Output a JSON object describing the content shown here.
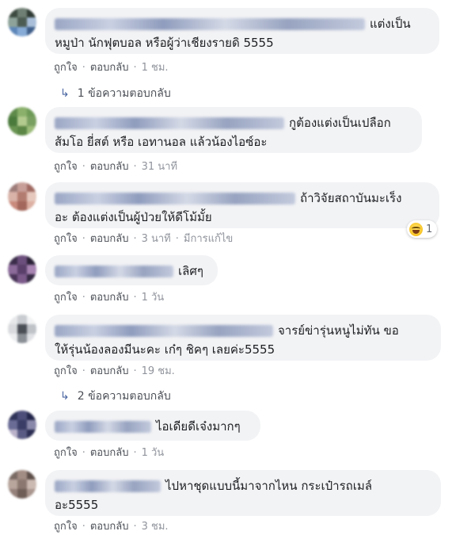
{
  "labels": {
    "like": "ถูกใจ",
    "reply": "ตอบกลับ",
    "edited": "มีการแก้ไข"
  },
  "comments": [
    {
      "text_line1": "แต่งเป็น",
      "text_line2": "หมูป่า นักฟุตบอล หรือผู้ว่าเชียงรายดิ 5555",
      "time": "1 ชม.",
      "replies": "1 ข้อความตอบกลับ"
    },
    {
      "text_line1": "กูต้องแต่งเป็นเปลือก",
      "text_line2": "ส้มโอ ยี่สต์ หรือ เอทานอล แล้วน้องไอซ์อะ",
      "time": "31 นาที"
    },
    {
      "text_line1": "ถ้าวิจัยสถาบันมะเร็ง",
      "text_line2": "อะ ต้องแต่งเป็นผู้ป่วยให้ดีโม้มั้ย",
      "time": "3 นาที",
      "reaction_count": "1"
    },
    {
      "text_line1": "เลิศๆ",
      "time": "1 วัน"
    },
    {
      "text_line1": "จารย์ข่ารุ่นหนูไม่ทัน ขอ",
      "text_line2": "ให้รุ่นน้องลองมีนะคะ เก๋ๆ ชิคๆ เลยค่ะ5555",
      "time": "19 ชม.",
      "replies": "2 ข้อความตอบกลับ"
    },
    {
      "text_line1": "ไอเดียดีเจ๋งมากๆ",
      "time": "1 วัน"
    },
    {
      "text_line1": "ไปหาชุดแบบนี้มาจากไหน กระเป๋ารถเมล์",
      "text_line2": "อะ5555",
      "time": "3 ชม."
    }
  ]
}
